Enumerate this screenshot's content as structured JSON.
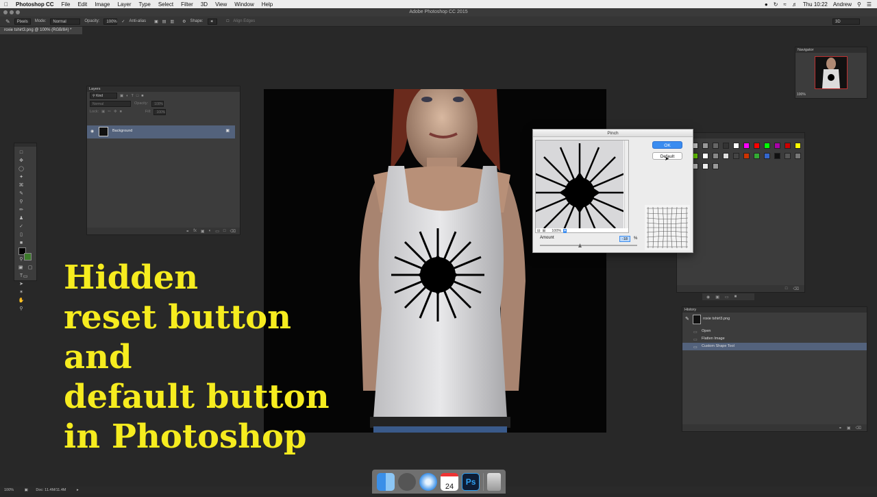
{
  "menubar": {
    "app_name": "Photoshop CC",
    "items": [
      "File",
      "Edit",
      "Image",
      "Layer",
      "Type",
      "Select",
      "Filter",
      "3D",
      "View",
      "Window",
      "Help"
    ],
    "clock": "Thu 10:22",
    "user": "Andrew"
  },
  "window": {
    "title": "Adobe Photoshop CC 2015"
  },
  "options_bar": {
    "tool_mode_value": "Pixels",
    "mode_label": "Mode:",
    "mode_value": "Normal",
    "opacity_label": "Opacity:",
    "opacity_value": "100%",
    "antialias_label": "Anti-alias",
    "shape_label": "Shape:",
    "align_edges_label": "Align Edges",
    "workspace_value": "3D"
  },
  "document": {
    "tab_label": "roxie tshirt3.png @ 100% (RGB/8#) *"
  },
  "layers_panel": {
    "title": "Layers",
    "filter_kind": "Kind",
    "blend_mode": "Normal",
    "opacity_label": "Opacity:",
    "opacity_value": "100%",
    "lock_label": "Lock:",
    "fill_label": "Fill:",
    "fill_value": "100%",
    "layers": [
      {
        "name": "Background"
      }
    ]
  },
  "navigator_panel": {
    "title": "Navigator",
    "zoom": "100%"
  },
  "history_panel": {
    "title": "History",
    "snapshot": "roxie tshirt3.png",
    "states": [
      "Open",
      "Flatten Image",
      "Custom Shape Tool"
    ]
  },
  "pinch_dialog": {
    "title": "Pinch",
    "ok_label": "OK",
    "default_label": "Default",
    "preview_zoom": "100%",
    "amount_label": "Amount",
    "amount_value": "-18",
    "amount_unit": "%"
  },
  "caption": {
    "lines": [
      "Hidden",
      "reset button",
      "and",
      "default button",
      "in Photoshop"
    ]
  },
  "status_bar": {
    "zoom": "100%",
    "doc_info": "Doc: 11.4M/11.4M"
  },
  "colors": {
    "caption_yellow": "#f6ec1f",
    "selected_layer": "#53627c",
    "ok_button": "#3a8cf0"
  },
  "swatch_colors": [
    "#cccccc",
    "#999999",
    "#666666",
    "#333333",
    "#ffffff",
    "#ff00ff",
    "#ff0000",
    "#00ff00",
    "#aa00aa",
    "#cc0000",
    "#ffff00",
    "#66cc00",
    "#ffffff",
    "#888888",
    "#e0e0e0",
    "#444444",
    "#cc3300",
    "#33aa33",
    "#3366cc",
    "#111111",
    "#555555",
    "#777777",
    "#bbbbbb",
    "#eeeeee",
    "#999999"
  ]
}
